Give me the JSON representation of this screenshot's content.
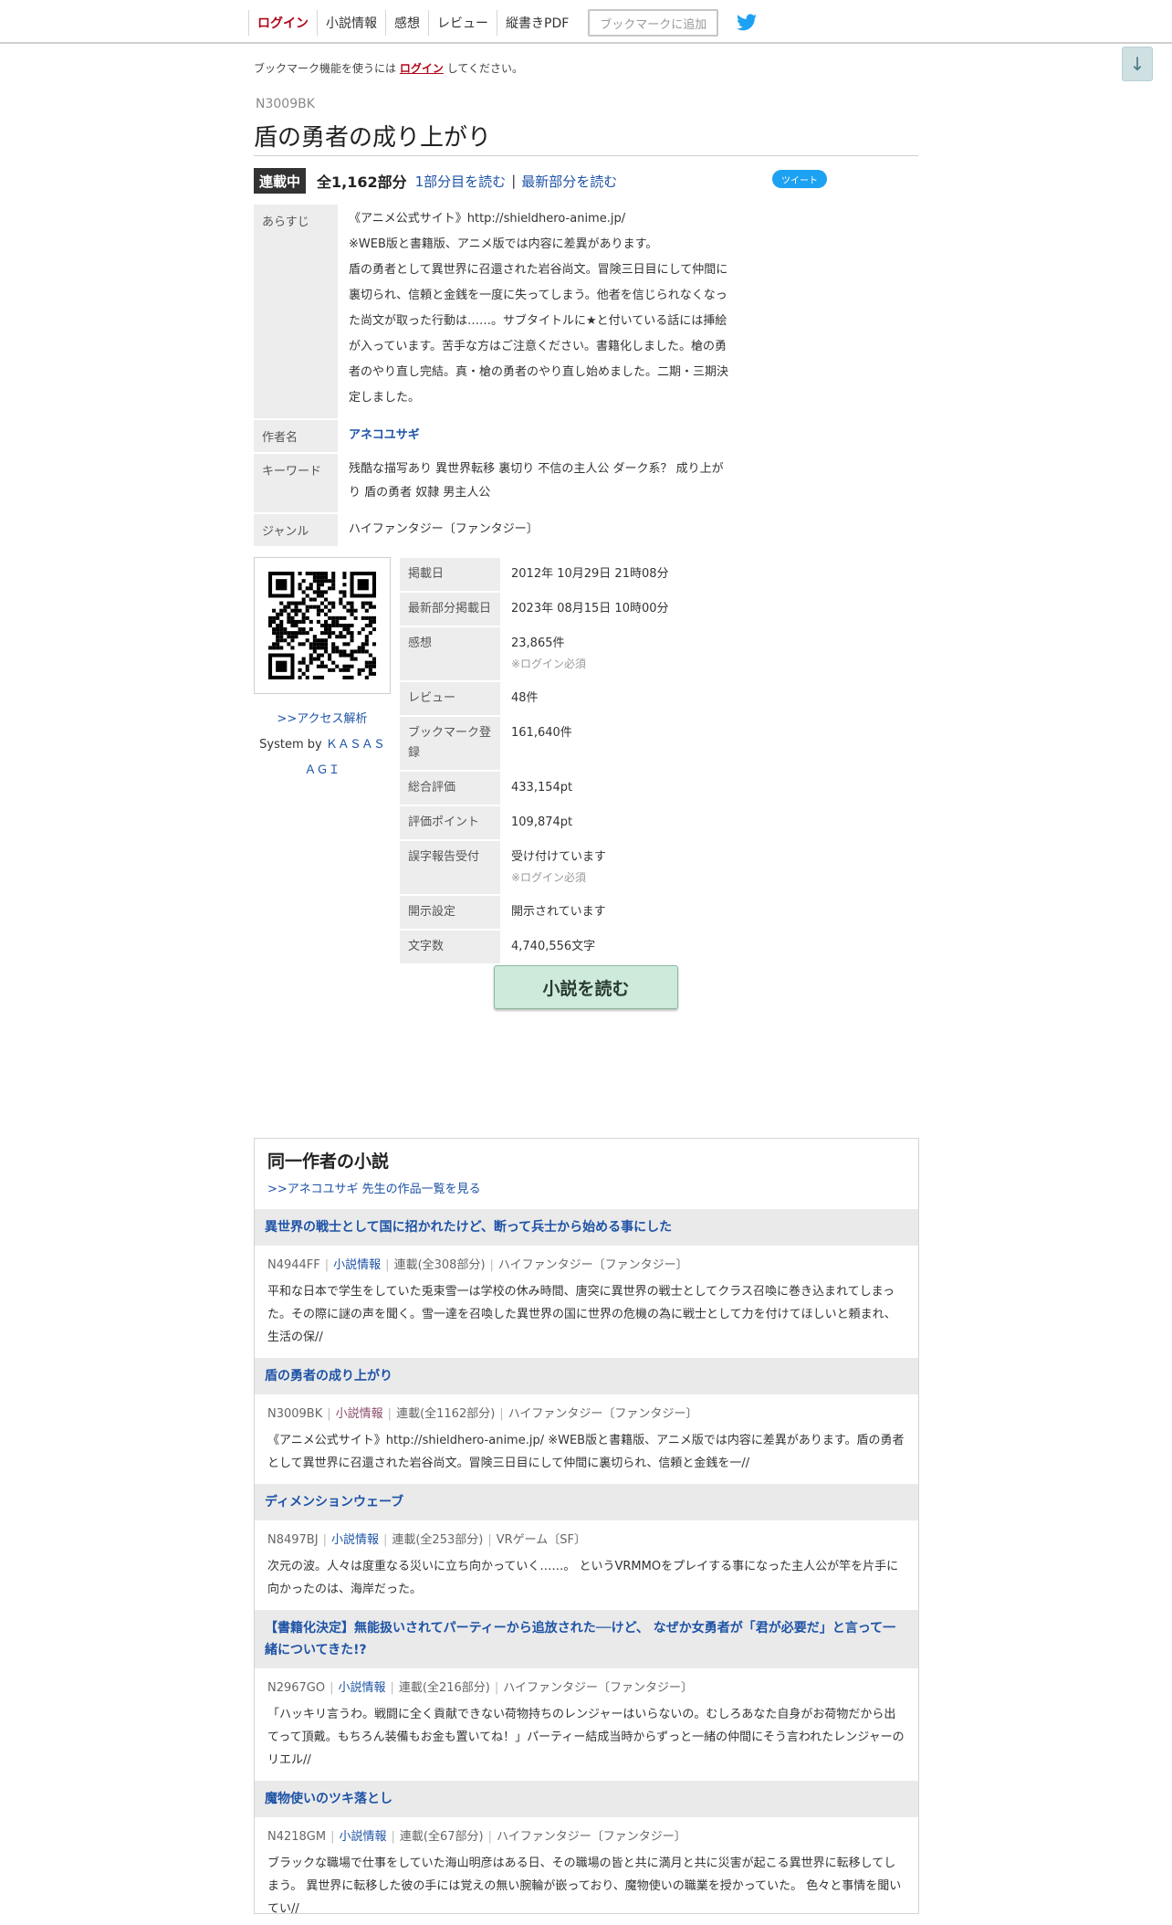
{
  "nav": {
    "items": [
      "ログイン",
      "小説情報",
      "感想",
      "レビュー",
      "縦書きPDF"
    ],
    "bookmark": "ブックマークに追加",
    "twitter_icon": "twitter-bird-icon"
  },
  "scroll_down": "↓",
  "notice": {
    "before": "ブックマーク機能を使うには",
    "link": "ログイン",
    "after": "してください。"
  },
  "novel": {
    "ncode": "N3009BK",
    "title": "盾の勇者の成り上がり",
    "status": "連載中",
    "total": "全1,162部分",
    "read_first": "1部分目を読む",
    "sep": "|",
    "read_latest": "最新部分を読む",
    "tweet": "ツイート"
  },
  "info": {
    "synopsis_label": "あらすじ",
    "synopsis": "《アニメ公式サイト》http://shieldhero-anime.jp/\n※WEB版と書籍版、アニメ版では内容に差異があります。\n盾の勇者として異世界に召還された岩谷尚文。冒険三日目にして仲間に裏切られ、信頼と金銭を一度に失ってしまう。他者を信じられなくなった尚文が取った行動は……。サブタイトルに★と付いている話には挿絵が入っています。苦手な方はご注意ください。書籍化しました。槍の勇者のやり直し完結。真・槍の勇者のやり直し始めました。二期・三期決定しました。",
    "author_label": "作者名",
    "author": "アネコユサギ",
    "keyword_label": "キーワード",
    "keywords": "残酷な描写あり 異世界転移 裏切り 不信の主人公 ダーク系？ 成り上がり 盾の勇者 奴隷 男主人公",
    "genre_label": "ジャンル",
    "genre": "ハイファンタジー〔ファンタジー〕"
  },
  "qr": {
    "icon": "qr-code-icon",
    "access": ">>アクセス解析",
    "system_by": "System by",
    "kasasagi": "ＫＡＳＡＳＡＧＩ"
  },
  "stats": [
    {
      "label": "掲載日",
      "value": "2012年 10月29日 21時08分",
      "note": ""
    },
    {
      "label": "最新部分掲載日",
      "value": "2023年 08月15日 10時00分",
      "note": ""
    },
    {
      "label": "感想",
      "value": "23,865件",
      "note": "※ログイン必須"
    },
    {
      "label": "レビュー",
      "value": "48件",
      "note": ""
    },
    {
      "label": "ブックマーク登録",
      "value": "161,640件",
      "note": ""
    },
    {
      "label": "総合評価",
      "value": "433,154pt",
      "note": ""
    },
    {
      "label": "評価ポイント",
      "value": "109,874pt",
      "note": ""
    },
    {
      "label": "誤字報告受付",
      "value": "受け付けています",
      "note": "※ログイン必須"
    },
    {
      "label": "開示設定",
      "value": "開示されています",
      "note": ""
    },
    {
      "label": "文字数",
      "value": "4,740,556文字",
      "note": ""
    }
  ],
  "read_button": "小説を読む",
  "same_author": {
    "title": "同一作者の小説",
    "list_link": ">>アネコユサギ 先生の作品一覧を見る",
    "works": [
      {
        "title": "異世界の戦士として国に招かれたけど、断って兵士から始める事にした",
        "ncode": "N4944FF",
        "info": "小説情報",
        "status": "連載(全308部分)",
        "genre": "ハイファンタジー〔ファンタジー〕",
        "summary": "平和な日本で学生をしていた兎束雪一は学校の休み時間、唐突に異世界の戦士としてクラス召喚に巻き込まれてしまった。その際に謎の声を聞く。雪一達を召喚した異世界の国に世界の危機の為に戦士として力を付けてほしいと頼まれ、生活の保//"
      },
      {
        "title": "盾の勇者の成り上がり",
        "ncode": "N3009BK",
        "info": "小説情報",
        "status": "連載(全1162部分)",
        "genre": "ハイファンタジー〔ファンタジー〕",
        "summary": "《アニメ公式サイト》http://shieldhero-anime.jp/ ※WEB版と書籍版、アニメ版では内容に差異があります。盾の勇者として異世界に召還された岩谷尚文。冒険三日目にして仲間に裏切られ、信頼と金銭を一//"
      },
      {
        "title": "ディメンションウェーブ",
        "ncode": "N8497BJ",
        "info": "小説情報",
        "status": "連載(全253部分)",
        "genre": "VRゲーム〔SF〕",
        "summary": "次元の波。人々は度重なる災いに立ち向かっていく……。 というVRMMOをプレイする事になった主人公が竿を片手に向かったのは、海岸だった。"
      },
      {
        "title": "【書籍化決定】無能扱いされてパーティーから追放された──けど、 なぜか女勇者が「君が必要だ」と言って一緒についてきた!?",
        "ncode": "N2967GO",
        "info": "小説情報",
        "status": "連載(全216部分)",
        "genre": "ハイファンタジー〔ファンタジー〕",
        "summary": "「ハッキリ言うわ。戦闘に全く貢献できない荷物持ちのレンジャーはいらないの。むしろあなた自身がお荷物だから出てって頂戴。もちろん装備もお金も置いてね！」パーティー結成当時からずっと一緒の仲間にそう言われたレンジャーのリエル//"
      },
      {
        "title": "魔物使いのツキ落とし",
        "ncode": "N4218GM",
        "info": "小説情報",
        "status": "連載(全67部分)",
        "genre": "ハイファンタジー〔ファンタジー〕",
        "summary": "ブラックな職場で仕事をしていた海山明彦はある日、その職場の皆と共に満月と共に災害が起こる異世界に転移してしまう。 異世界に転移した彼の手には覚えの無い腕輪が嵌っており、魔物使いの職業を授かっていた。 色々と事情を聞いてい//"
      }
    ]
  }
}
